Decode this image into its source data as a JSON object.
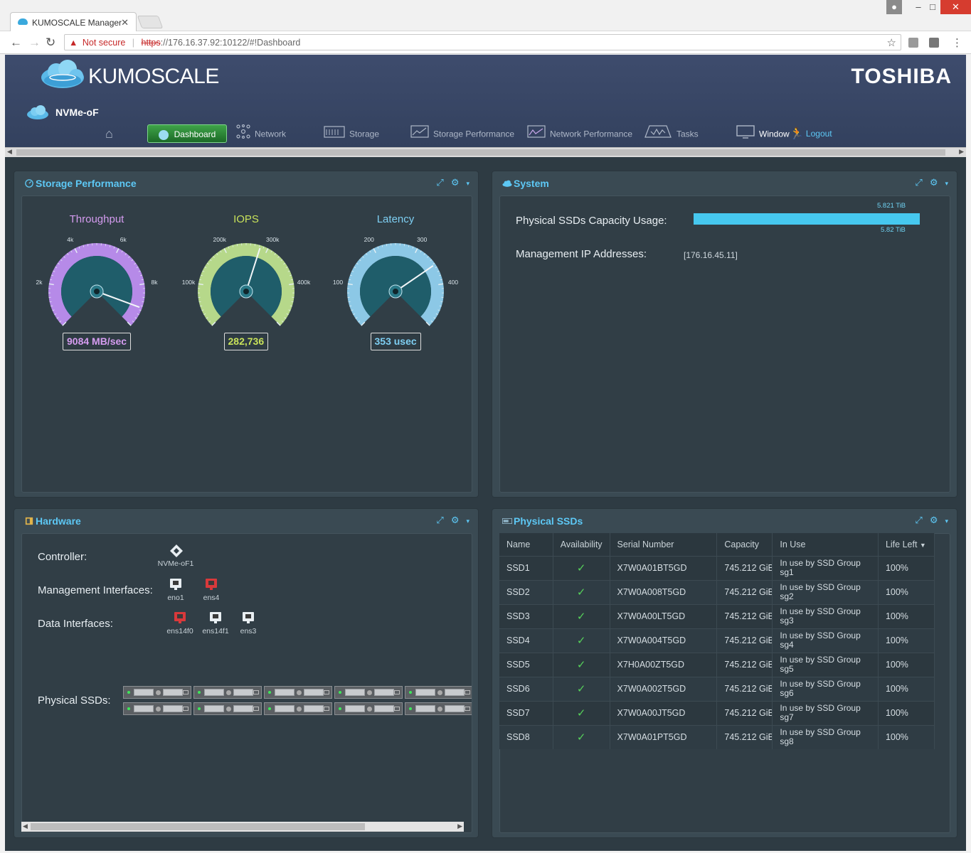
{
  "browser": {
    "tab_title": "KUMOSCALE Manager",
    "security_label": "Not secure",
    "url_scheme": "https",
    "url_rest": "://176.16.37.92:10122/#!Dashboard"
  },
  "app": {
    "logo_text": "KUMOSCALE",
    "brand": "TOSHIBA",
    "subsystem": "NVMe-oF"
  },
  "nav": {
    "items": [
      {
        "label": "Dashboard",
        "icon": "dashboard-icon"
      },
      {
        "label": "Network",
        "icon": "network-icon"
      },
      {
        "label": "Storage",
        "icon": "storage-icon"
      },
      {
        "label": "Storage Performance",
        "icon": "storage-performance-icon"
      },
      {
        "label": "Network Performance",
        "icon": "network-performance-icon"
      },
      {
        "label": "Tasks",
        "icon": "tasks-icon"
      },
      {
        "label": "Window",
        "icon": "window-icon"
      },
      {
        "label": "Logout",
        "icon": "logout-icon"
      }
    ]
  },
  "storage_performance": {
    "title": "Storage Performance",
    "gauges": [
      {
        "title": "Throughput",
        "value_text": "9084 MB/sec",
        "value": 9084,
        "max": 10000,
        "ticks": [
          "0",
          "2k",
          "4k",
          "6k",
          "8k",
          "10k"
        ],
        "color": "#b68ae8",
        "label_color": "#d59cf0"
      },
      {
        "title": "IOPS",
        "value_text": "282,736",
        "value": 282736,
        "max": 500000,
        "ticks": [
          "0",
          "100k",
          "200k",
          "300k",
          "400k",
          "500k"
        ],
        "color": "#b6d88a",
        "label_color": "#c8e25a"
      },
      {
        "title": "Latency",
        "value_text": "353 usec",
        "value": 353,
        "max": 500,
        "ticks": [
          "0",
          "100",
          "200",
          "300",
          "400",
          "500"
        ],
        "color": "#8cc8e6",
        "label_color": "#7ecff3"
      }
    ]
  },
  "system": {
    "title": "System",
    "capacity_label": "Physical SSDs Capacity Usage:",
    "capacity_total": "5.821 TiB",
    "capacity_used": "5.82 TiB",
    "capacity_fraction": 1.0,
    "mgmt_ip_label": "Management IP Addresses:",
    "mgmt_ip_value": "[176.16.45.11]"
  },
  "hardware": {
    "title": "Hardware",
    "controller_label": "Controller:",
    "controller_name": "NVMe-oF1",
    "mgmt_label": "Management Interfaces:",
    "mgmt_interfaces": [
      {
        "name": "eno1",
        "status": "up"
      },
      {
        "name": "ens4",
        "status": "down"
      }
    ],
    "data_label": "Data Interfaces:",
    "data_interfaces": [
      {
        "name": "ens14f0",
        "status": "down"
      },
      {
        "name": "ens14f1",
        "status": "up"
      },
      {
        "name": "ens3",
        "status": "up"
      }
    ],
    "ssd_label": "Physical SSDs:"
  },
  "physical_ssds": {
    "title": "Physical SSDs",
    "columns": [
      "Name",
      "Availability",
      "Serial Number",
      "Capacity",
      "In Use",
      "Life Left"
    ],
    "rows": [
      {
        "name": "SSD1",
        "serial": "X7W0A01BT5GD",
        "capacity": "745.212 GiB",
        "inuse_line1": "In use by SSD Group",
        "inuse_line2": "sg1",
        "life": "100%"
      },
      {
        "name": "SSD2",
        "serial": "X7W0A008T5GD",
        "capacity": "745.212 GiB",
        "inuse_line1": "In use by SSD Group",
        "inuse_line2": "sg2",
        "life": "100%"
      },
      {
        "name": "SSD3",
        "serial": "X7W0A00LT5GD",
        "capacity": "745.212 GiB",
        "inuse_line1": "In use by SSD Group",
        "inuse_line2": "sg3",
        "life": "100%"
      },
      {
        "name": "SSD4",
        "serial": "X7W0A004T5GD",
        "capacity": "745.212 GiB",
        "inuse_line1": "In use by SSD Group",
        "inuse_line2": "sg4",
        "life": "100%"
      },
      {
        "name": "SSD5",
        "serial": "X7H0A00ZT5GD",
        "capacity": "745.212 GiB",
        "inuse_line1": "In use by SSD Group",
        "inuse_line2": "sg5",
        "life": "100%"
      },
      {
        "name": "SSD6",
        "serial": "X7W0A002T5GD",
        "capacity": "745.212 GiB",
        "inuse_line1": "In use by SSD Group",
        "inuse_line2": "sg6",
        "life": "100%"
      },
      {
        "name": "SSD7",
        "serial": "X7W0A00JT5GD",
        "capacity": "745.212 GiB",
        "inuse_line1": "In use by SSD Group",
        "inuse_line2": "sg7",
        "life": "100%"
      },
      {
        "name": "SSD8",
        "serial": "X7W0A01PT5GD",
        "capacity": "745.212 GiB",
        "inuse_line1": "In use by SSD Group",
        "inuse_line2": "sg8",
        "life": "100%"
      }
    ]
  }
}
